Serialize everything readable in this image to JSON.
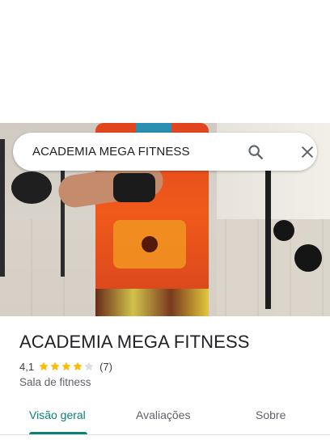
{
  "search": {
    "query": "ACADEMIA MEGA FITNESS"
  },
  "icons": {
    "search": "search-icon",
    "close": "close-icon",
    "star": "star-icon"
  },
  "place": {
    "name": "ACADEMIA MEGA FITNESS",
    "rating": "4,1",
    "rating_value": 4.1,
    "stars_max": 5,
    "review_count": "(7)",
    "category": "Sala de fitness"
  },
  "tabs": [
    {
      "label": "Visão geral",
      "active": true
    },
    {
      "label": "Avaliações",
      "active": false
    },
    {
      "label": "Sobre",
      "active": false
    }
  ],
  "colors": {
    "accent": "#0b8078",
    "star_filled": "#fbbc04",
    "star_empty": "#dadce0"
  }
}
